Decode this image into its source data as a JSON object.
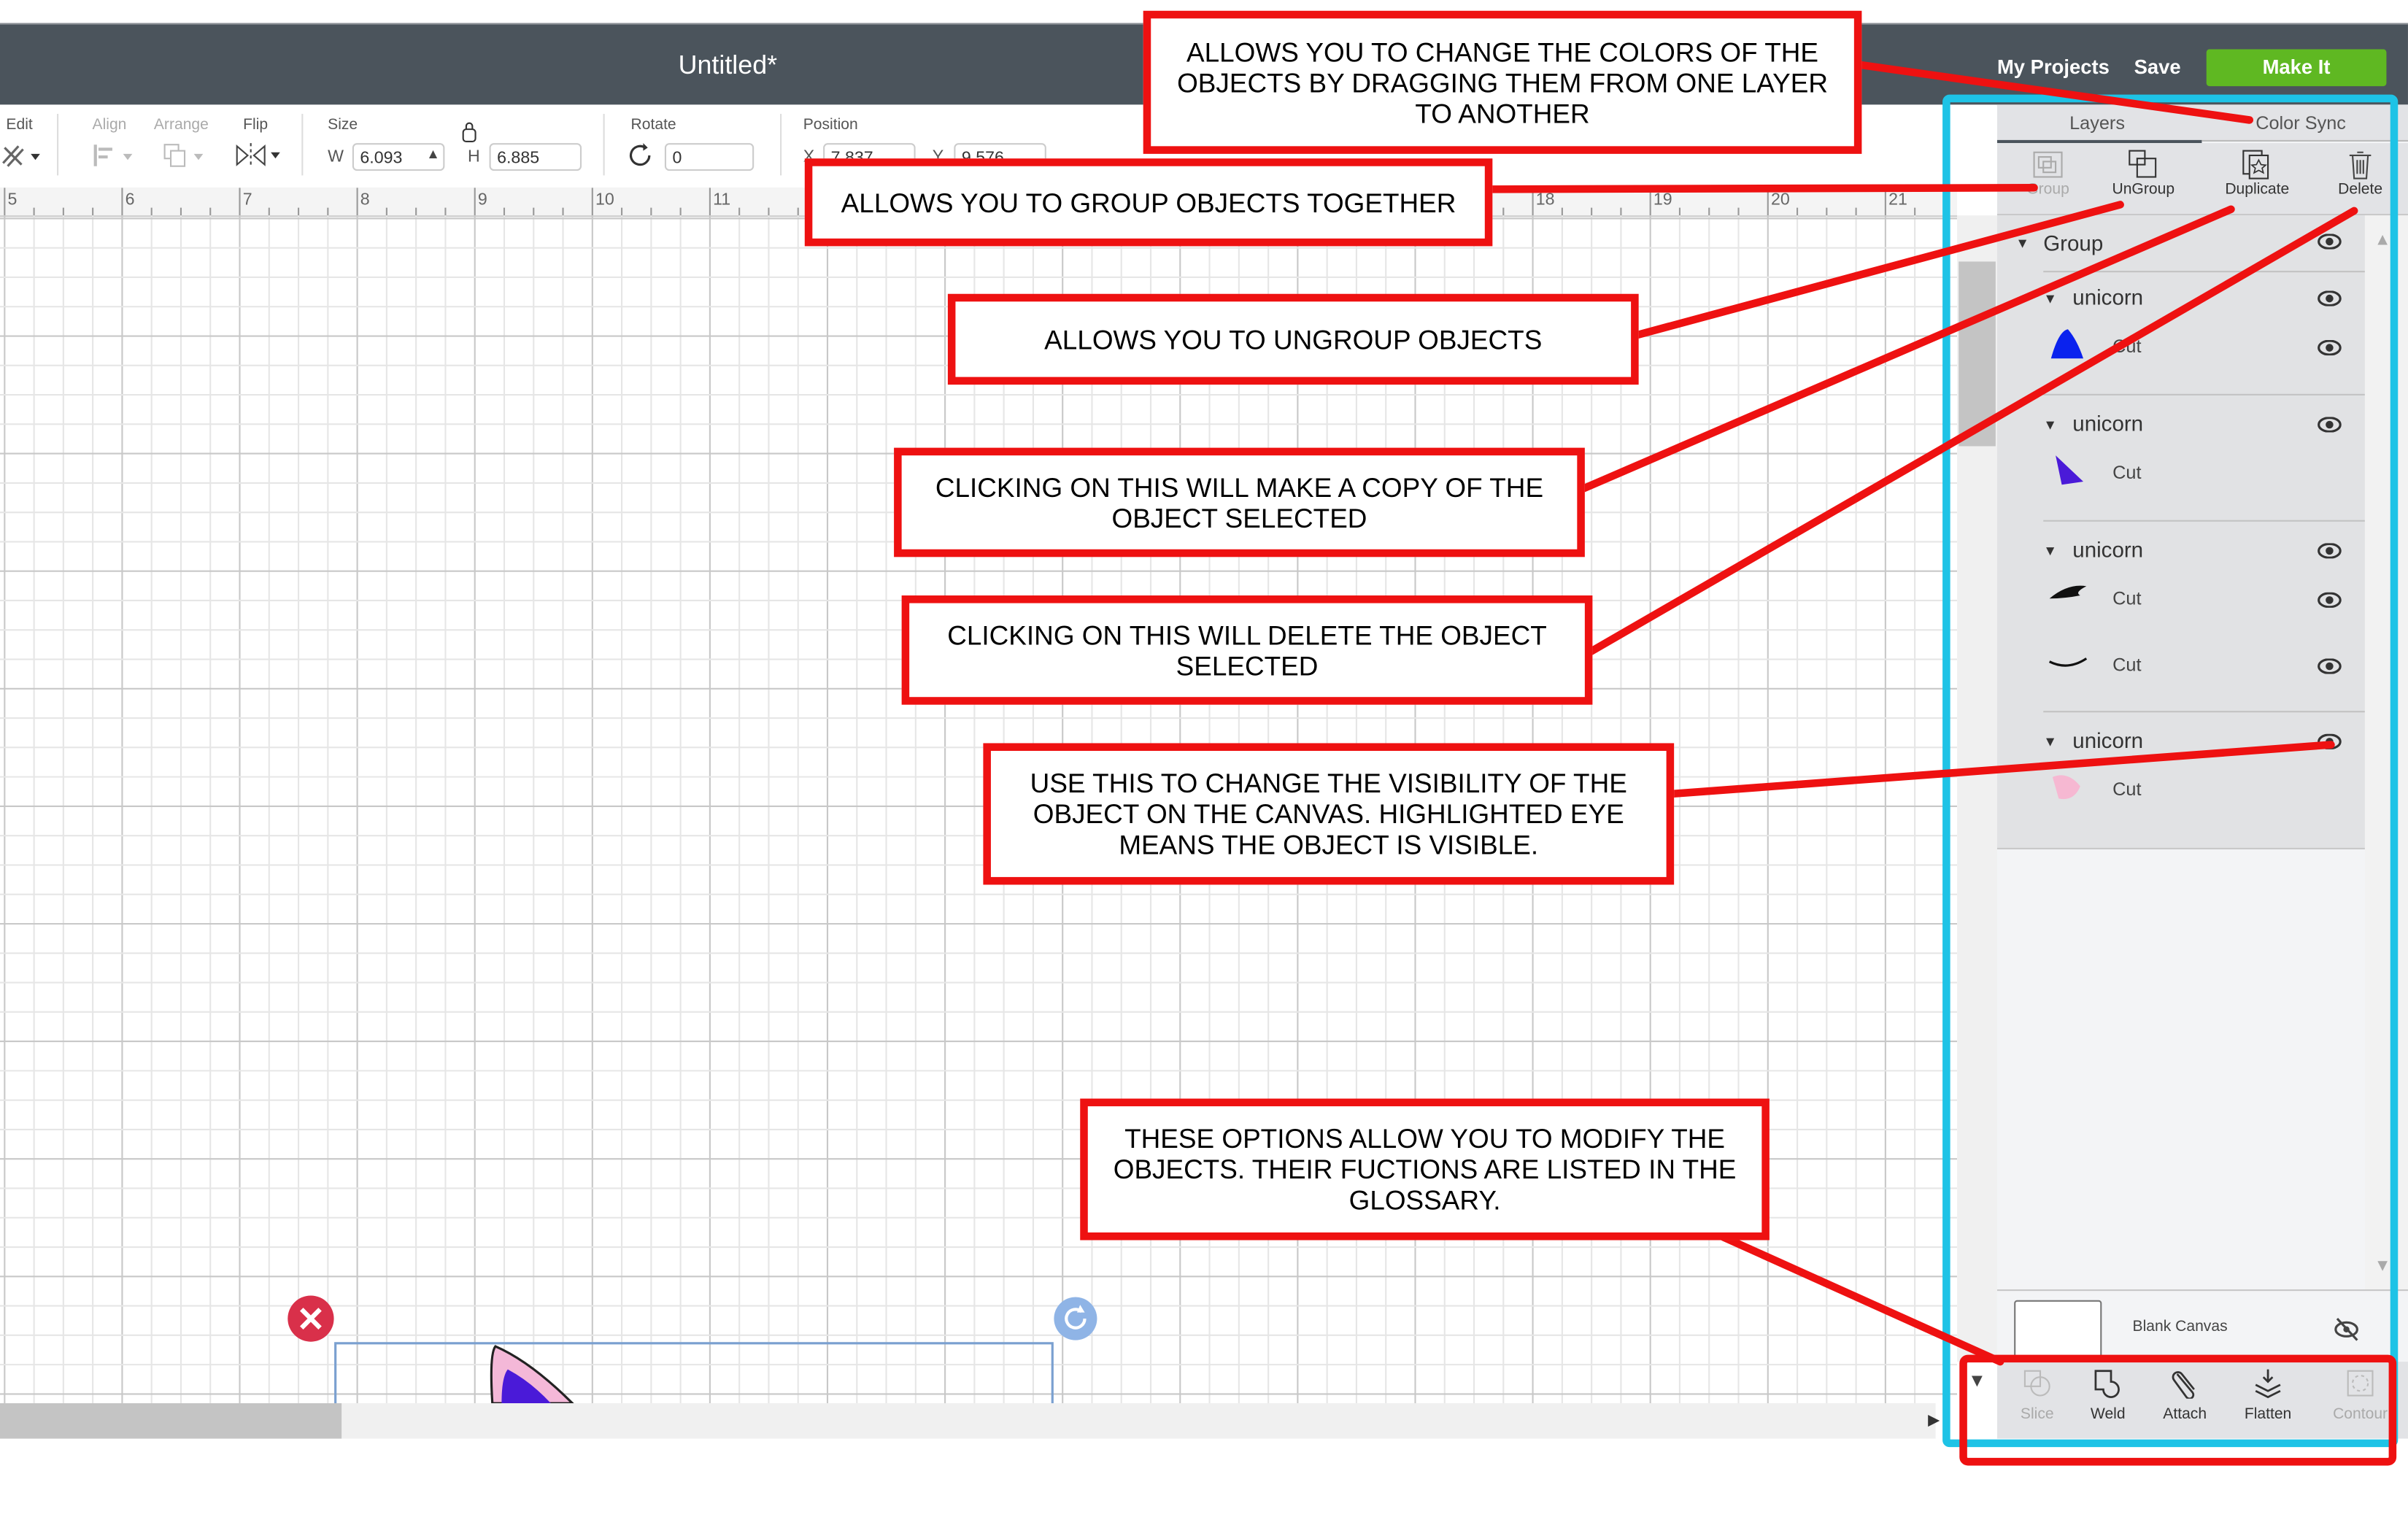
{
  "header": {
    "title": "Untitled*",
    "my_projects": "My Projects",
    "save": "Save",
    "make_it": "Make It",
    "make_it_color": "#5fb822"
  },
  "toolbar": {
    "edit": "Edit",
    "align": "Align",
    "arrange": "Arrange",
    "flip": "Flip",
    "size": "Size",
    "w_label": "W",
    "w_value": "6.093",
    "h_label": "H",
    "h_value": "6.885",
    "rotate": "Rotate",
    "rotate_value": "0",
    "position": "Position",
    "x_label": "X",
    "x_value": "7.837",
    "y_label": "Y",
    "y_value": "9.576"
  },
  "ruler": {
    "labels": [
      "5",
      "6",
      "7",
      "8",
      "9",
      "10",
      "11",
      "18",
      "19",
      "20",
      "21"
    ]
  },
  "panel": {
    "tabs": [
      "Layers",
      "Color Sync"
    ],
    "tools": [
      {
        "label": "Group",
        "icon": "group-icon",
        "enabled": false
      },
      {
        "label": "UnGroup",
        "icon": "ungroup-icon",
        "enabled": true
      },
      {
        "label": "Duplicate",
        "icon": "duplicate-icon",
        "enabled": true
      },
      {
        "label": "Delete",
        "icon": "trash-icon",
        "enabled": true
      }
    ],
    "layers": {
      "group": "Group",
      "items": [
        {
          "name": "unicorn",
          "cuts": [
            "Cut"
          ]
        },
        {
          "name": "unicorn",
          "cuts": [
            "Cut"
          ]
        },
        {
          "name": "unicorn",
          "cuts": [
            "Cut",
            "Cut"
          ]
        },
        {
          "name": "unicorn",
          "cuts": [
            "Cut"
          ]
        }
      ]
    },
    "blank_canvas": "Blank Canvas",
    "bottom_tools": [
      {
        "label": "Slice",
        "icon": "slice-icon",
        "enabled": false
      },
      {
        "label": "Weld",
        "icon": "weld-icon",
        "enabled": true
      },
      {
        "label": "Attach",
        "icon": "paperclip-icon",
        "enabled": true
      },
      {
        "label": "Flatten",
        "icon": "flatten-icon",
        "enabled": true
      },
      {
        "label": "Contour",
        "icon": "contour-icon",
        "enabled": false
      }
    ]
  },
  "callouts": {
    "color_sync": "Allows you to change the colors of the objects by dragging them from one layer to another",
    "group": "Allows you to group objects together",
    "ungroup": "Allows you to ungroup objects",
    "duplicate": "Clicking on this will make a copy of the object selected",
    "delete": "Clicking on this will delete the object selected",
    "visibility": "Use this to change the visibility of the object on the canvas. Highlighted eye means the object is visible.",
    "modify": "These options allow you to modify the objects. Their fuctions are listed in the glossary."
  },
  "colors": {
    "annotation_red": "#ee1111",
    "highlight_cyan": "#1ec3e6",
    "topbar": "#4b545c"
  }
}
